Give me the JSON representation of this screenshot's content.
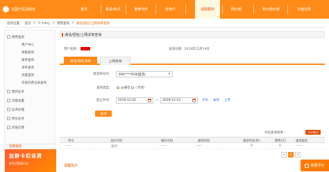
{
  "nav": {
    "brand": "全国产品及服务",
    "items": [
      {
        "label": "首页",
        "active": false
      },
      {
        "label": "看看/资讯",
        "active": false
      },
      {
        "label": "宽带光纤",
        "active": false
      },
      {
        "label": "全用户",
        "active": false
      },
      {
        "label": "自助服务",
        "active": true
      },
      {
        "label": "网厅组",
        "active": false
      },
      {
        "label": "积分俱乐部",
        "active": false
      },
      {
        "label": "充值交费",
        "active": false
      }
    ]
  },
  "breadcrumb": {
    "prefix": "您的位置：",
    "items": [
      "首页",
      "个人中心",
      "费用查询",
      "通话/短信/上网详单查询"
    ]
  },
  "sidebar": {
    "items": [
      {
        "label": "费用查询",
        "level": 1
      },
      {
        "label": "用户中心",
        "level": 2
      },
      {
        "label": "余额查询",
        "level": 2
      },
      {
        "label": "账单查询",
        "level": 2
      },
      {
        "label": "详单查询",
        "level": 2,
        "active": true
      },
      {
        "label": "流量查询",
        "level": 2
      },
      {
        "label": "充值交费记录查询",
        "level": 2
      },
      {
        "label": "我的业务",
        "level": 1
      },
      {
        "label": "功能设置",
        "level": 1
      },
      {
        "label": "业务办理",
        "level": 1
      },
      {
        "label": "积分业务",
        "level": 1
      },
      {
        "label": "充值交费",
        "level": 1
      }
    ],
    "footer": "话费通道",
    "banner_title": "加群卡扣话费",
    "banner_sub": "更多优惠请点击"
  },
  "panel": {
    "title": "通话/短信/上网详单查询"
  },
  "info": {
    "user_label": "用户名称：",
    "date_label": "查询日期：",
    "date_value": "2019年12月19日"
  },
  "tabs": [
    {
      "label": "通话/短信清单",
      "active": true
    },
    {
      "label": "上网清单",
      "active": false
    }
  ],
  "form": {
    "number_label": "请选择号码：",
    "number_value": "694****928(固话)",
    "type_label": "查询类型：",
    "type_options": [
      "@通话",
      "○代扣"
    ],
    "period_label": "起止时间：",
    "start_date": "2019-12-01",
    "end_date": "2019-12-15",
    "quick_links": [
      "今天",
      "本月",
      "上月"
    ],
    "query_button": "查询"
  },
  "export": {
    "label": "导出查询结果：",
    "pdf_button": "PDF格式"
  },
  "table": {
    "headers": [
      "序号",
      "主叫号码",
      "被叫号码",
      "通话时间",
      "通话时长(秒)",
      "费用(元)",
      "通话类型"
    ],
    "rows": [
      {
        "cells": [
          "------",
          "总计：",
          "------",
          "------",
          "0",
          "0",
          "------"
        ]
      }
    ]
  },
  "pager": [
    "<",
    "1",
    ">"
  ],
  "tips": "温馨提示",
  "feedback": "我要评价"
}
